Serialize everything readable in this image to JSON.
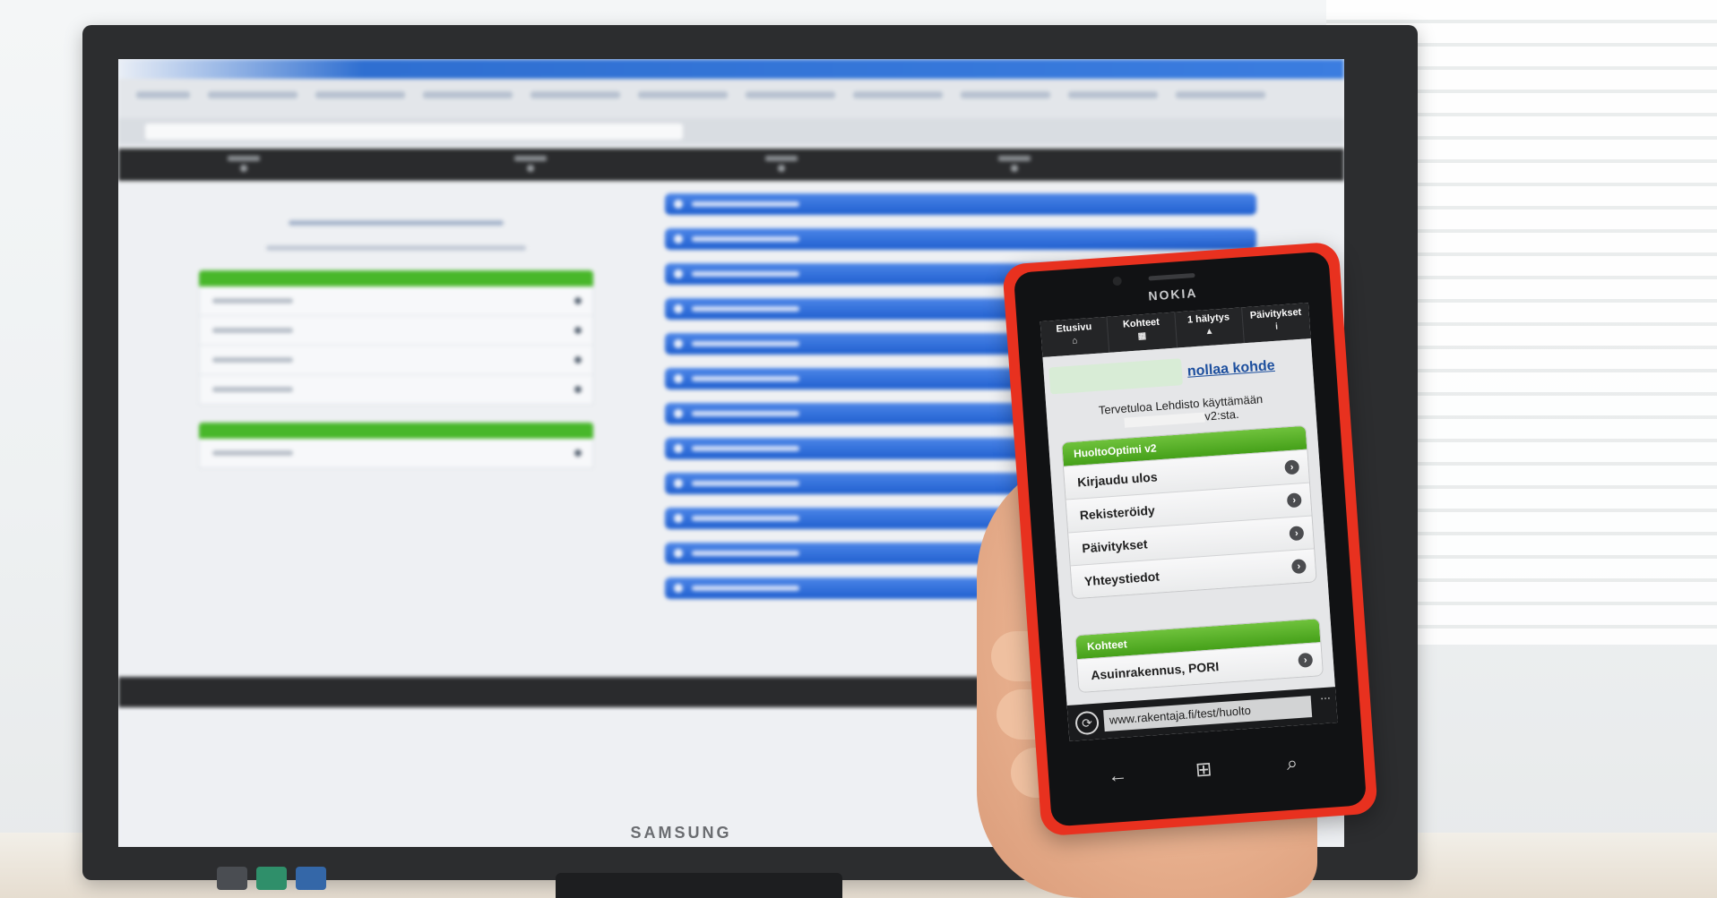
{
  "monitor": {
    "brand": "SAMSUNG"
  },
  "phone": {
    "brand": "NOKIA",
    "nav_tabs": [
      {
        "label": "Etusivu",
        "icon": "home-icon"
      },
      {
        "label": "Kohteet",
        "icon": "grid-icon"
      },
      {
        "label": "1 hälytys",
        "icon": "alert-icon"
      },
      {
        "label": "Päivitykset",
        "icon": "info-icon"
      }
    ],
    "reset_link": "nollaa kohde",
    "welcome_line1": "Tervetuloa Lehdisto käyttämään",
    "welcome_line2_suffix": "v2:sta.",
    "group1": {
      "title": "HuoltoOptimi v2",
      "items": [
        "Kirjaudu ulos",
        "Rekisteröidy",
        "Päivitykset",
        "Yhteystiedot"
      ]
    },
    "group2": {
      "title": "Kohteet",
      "items": [
        "Asuinrakennus, PORI"
      ]
    },
    "address_bar": {
      "url": "www.rakentaja.fi/test/huolto",
      "more": "..."
    },
    "colors": {
      "body": "#e8311f",
      "group_header": "#45a019",
      "link": "#1d4f9e"
    }
  }
}
